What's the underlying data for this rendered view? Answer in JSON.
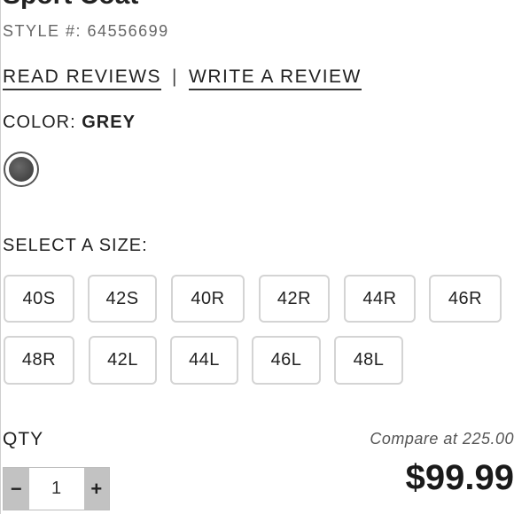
{
  "product": {
    "title": "Sport Coat",
    "style_prefix": "STYLE #: ",
    "style_number": "64556699"
  },
  "reviews": {
    "read_label": "READ REVIEWS",
    "separator": "|",
    "write_label": "WRITE A REVIEW"
  },
  "color": {
    "label": "COLOR: ",
    "selected": "GREY",
    "swatch_color": "#4a4a4a"
  },
  "size": {
    "label": "SELECT A SIZE:",
    "options": [
      "40S",
      "42S",
      "40R",
      "42R",
      "44R",
      "46R",
      "48R",
      "42L",
      "44L",
      "46L",
      "48L"
    ]
  },
  "quantity": {
    "label": "QTY",
    "value": "1",
    "decrement_label": "−",
    "increment_label": "+"
  },
  "pricing": {
    "compare_text": "Compare at 225.00",
    "price": "$99.99"
  }
}
